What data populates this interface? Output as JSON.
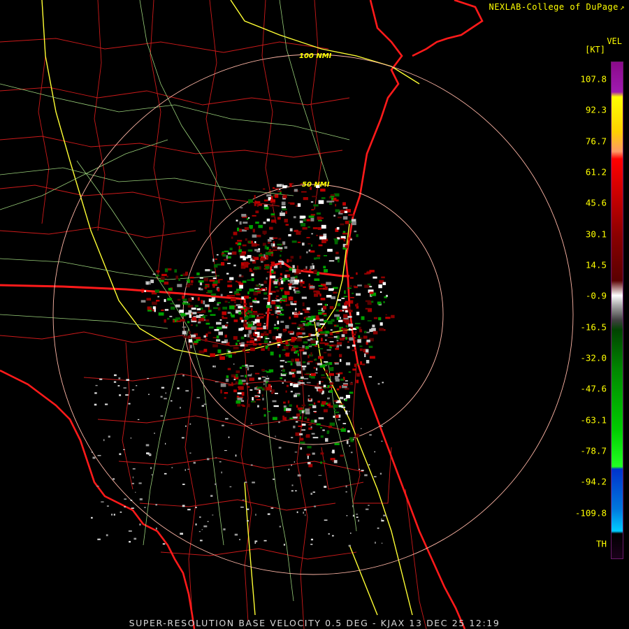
{
  "header": {
    "credit": "NEXLAB-College of DuPage",
    "credit_icon": "external-link-icon",
    "product_code": "VEL",
    "unit": "[KT]"
  },
  "rings": [
    {
      "label": "100 NMI"
    },
    {
      "label": "50 NMI"
    }
  ],
  "colorbar": {
    "ticks": [
      "107.8",
      "92.3",
      "76.7",
      "61.2",
      "45.6",
      "30.1",
      "14.5",
      "-0.9",
      "-16.5",
      "-32.0",
      "-47.6",
      "-63.1",
      "-78.7",
      "-94.2",
      "-109.8",
      "TH"
    ],
    "colors": {
      "purple": "#8a0a8a",
      "yellow": "#ffff00",
      "orange": "#ff9966",
      "red": "#ff0000",
      "darkred": "#5a0000",
      "gray": "#aaaaaa",
      "green": "#00cc00",
      "darkgreen": "#004400",
      "blue": "#0033cc",
      "cyan": "#00ccff"
    }
  },
  "footer": {
    "text": "SUPER-RESOLUTION BASE VELOCITY 0.5 DEG - KJAX 13 DEC 25 12:19"
  }
}
